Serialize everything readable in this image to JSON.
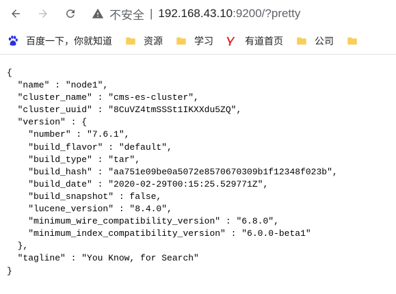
{
  "browser": {
    "security_label": "不安全",
    "url_host": "192.168.43.10",
    "url_rest": ":9200/?pretty"
  },
  "bookmarks": [
    {
      "label": "百度一下，你就知道",
      "icon": "baidu-paw-icon"
    },
    {
      "label": "资源",
      "icon": "folder-icon"
    },
    {
      "label": "学习",
      "icon": "folder-icon"
    },
    {
      "label": "有道首页",
      "icon": "youdao-logo-icon"
    },
    {
      "label": "公司",
      "icon": "folder-icon"
    }
  ],
  "json_lines": [
    "{",
    "  \"name\" : \"node1\",",
    "  \"cluster_name\" : \"cms-es-cluster\",",
    "  \"cluster_uuid\" : \"8CuVZ4tmSSSt1IKXXdu5ZQ\",",
    "  \"version\" : {",
    "    \"number\" : \"7.6.1\",",
    "    \"build_flavor\" : \"default\",",
    "    \"build_type\" : \"tar\",",
    "    \"build_hash\" : \"aa751e09be0a5072e8570670309b1f12348f023b\",",
    "    \"build_date\" : \"2020-02-29T00:15:25.529771Z\",",
    "    \"build_snapshot\" : false,",
    "    \"lucene_version\" : \"8.4.0\",",
    "    \"minimum_wire_compatibility_version\" : \"6.8.0\",",
    "    \"minimum_index_compatibility_version\" : \"6.0.0-beta1\"",
    "  },",
    "  \"tagline\" : \"You Know, for Search\"",
    "}"
  ],
  "colors": {
    "baidu_blue": "#2932e1",
    "youdao_red": "#e1272b",
    "folder_yellow": "#f7cf5a"
  }
}
